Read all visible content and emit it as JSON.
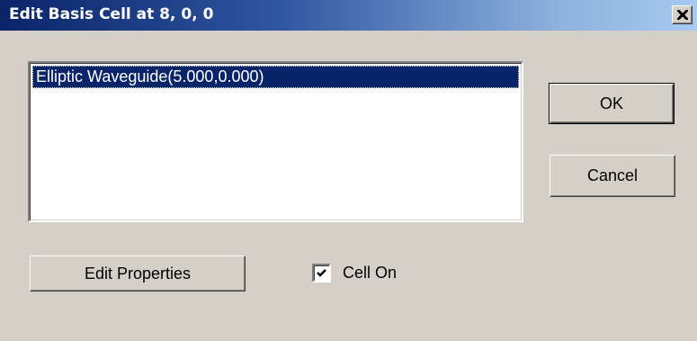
{
  "window": {
    "title": "Edit Basis Cell at 8, 0, 0",
    "close_symbol": "✕"
  },
  "list": {
    "items": [
      {
        "label": "Elliptic Waveguide(5.000,0.000)",
        "selected": true
      }
    ]
  },
  "buttons": {
    "ok_label": "OK",
    "cancel_label": "Cancel",
    "edit_properties_label": "Edit Properties"
  },
  "cell_on": {
    "label": "Cell On",
    "checked": true
  },
  "colors": {
    "titlebar_start": "#0a246a",
    "titlebar_end": "#a6caf0",
    "selection": "#0a246a",
    "face": "#d4d0c8"
  },
  "icons": {
    "close": "close-icon",
    "check": "checkmark-icon"
  }
}
